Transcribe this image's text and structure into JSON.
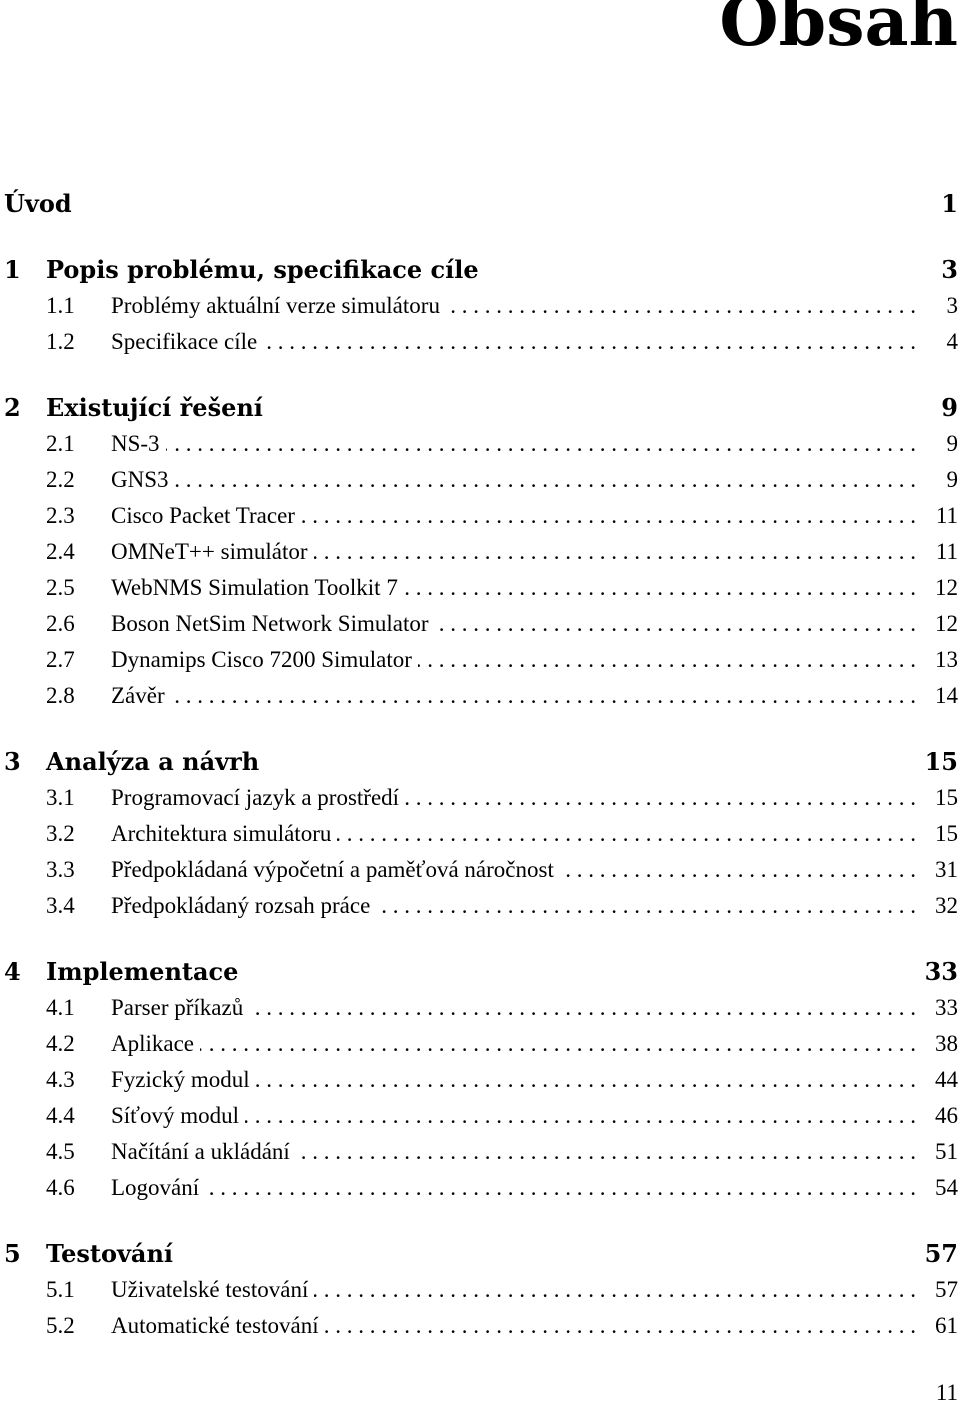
{
  "title": "Obsah",
  "toc": [
    {
      "num": "",
      "label": "Úvod",
      "page": "1",
      "sections": []
    },
    {
      "num": "1",
      "label": "Popis problému, specifikace cíle",
      "page": "3",
      "sections": [
        {
          "num": "1.1",
          "label": "Problémy aktuální verze simulátoru",
          "page": "3"
        },
        {
          "num": "1.2",
          "label": "Specifikace cíle",
          "page": "4"
        }
      ]
    },
    {
      "num": "2",
      "label": "Existující řešení",
      "page": "9",
      "sections": [
        {
          "num": "2.1",
          "label": "NS-3",
          "page": "9"
        },
        {
          "num": "2.2",
          "label": "GNS3",
          "page": "9"
        },
        {
          "num": "2.3",
          "label": "Cisco Packet Tracer",
          "page": "11"
        },
        {
          "num": "2.4",
          "label": "OMNeT++ simulátor",
          "page": "11"
        },
        {
          "num": "2.5",
          "label": "WebNMS Simulation Toolkit 7",
          "page": "12"
        },
        {
          "num": "2.6",
          "label": "Boson NetSim Network Simulator",
          "page": "12"
        },
        {
          "num": "2.7",
          "label": "Dynamips Cisco 7200 Simulator",
          "page": "13"
        },
        {
          "num": "2.8",
          "label": "Závěr",
          "page": "14"
        }
      ]
    },
    {
      "num": "3",
      "label": "Analýza a návrh",
      "page": "15",
      "sections": [
        {
          "num": "3.1",
          "label": "Programovací jazyk a prostředí",
          "page": "15"
        },
        {
          "num": "3.2",
          "label": "Architektura simulátoru",
          "page": "15"
        },
        {
          "num": "3.3",
          "label": "Předpokládaná výpočetní a paměťová náročnost",
          "page": "31"
        },
        {
          "num": "3.4",
          "label": "Předpokládaný rozsah práce",
          "page": "32"
        }
      ]
    },
    {
      "num": "4",
      "label": "Implementace",
      "page": "33",
      "sections": [
        {
          "num": "4.1",
          "label": "Parser příkazů",
          "page": "33"
        },
        {
          "num": "4.2",
          "label": "Aplikace",
          "page": "38"
        },
        {
          "num": "4.3",
          "label": "Fyzický modul",
          "page": "44"
        },
        {
          "num": "4.4",
          "label": "Síťový modul",
          "page": "46"
        },
        {
          "num": "4.5",
          "label": "Načítání a ukládání",
          "page": "51"
        },
        {
          "num": "4.6",
          "label": "Logování",
          "page": "54"
        }
      ]
    },
    {
      "num": "5",
      "label": "Testování",
      "page": "57",
      "sections": [
        {
          "num": "5.1",
          "label": "Uživatelské testování",
          "page": "57"
        },
        {
          "num": "5.2",
          "label": "Automatické testování",
          "page": "61"
        }
      ]
    }
  ],
  "page_number": "11"
}
